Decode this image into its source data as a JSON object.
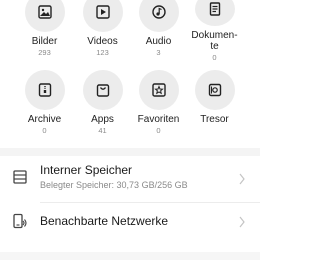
{
  "categories": [
    {
      "label": "Bilder",
      "count": "293",
      "icon": "image-icon"
    },
    {
      "label": "Videos",
      "count": "123",
      "icon": "video-icon"
    },
    {
      "label": "Audio",
      "count": "3",
      "icon": "music-icon"
    },
    {
      "label": "Dokumen-\nte",
      "count": "0",
      "icon": "document-icon"
    },
    {
      "label": "Archive",
      "count": "0",
      "icon": "archive-icon"
    },
    {
      "label": "Apps",
      "count": "41",
      "icon": "apps-icon"
    },
    {
      "label": "Favoriten",
      "count": "0",
      "icon": "star-icon"
    },
    {
      "label": "Tresor",
      "count": "",
      "icon": "safe-icon"
    }
  ],
  "storage": {
    "title": "Interner Speicher",
    "subtitle": "Belegter Speicher: 30,73 GB/256 GB",
    "icon": "storage-icon"
  },
  "network": {
    "title": "Benachbarte Netzwerke",
    "icon": "network-device-icon"
  },
  "colors": {
    "icon_bg": "#ececec",
    "icon_fg": "#222222",
    "muted_text": "#8a8a8a",
    "separator": "#f4f4f4"
  }
}
